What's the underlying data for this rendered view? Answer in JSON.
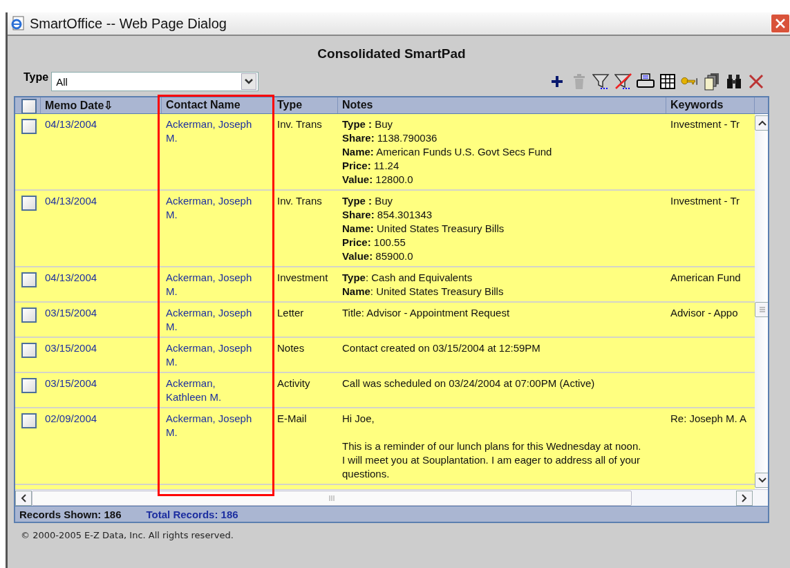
{
  "window": {
    "title": "SmartOffice -- Web Page Dialog"
  },
  "heading": "Consolidated SmartPad",
  "filter": {
    "label": "Type",
    "value": "All"
  },
  "toolbar": [
    {
      "kind": "add",
      "disabled": false
    },
    {
      "kind": "delete",
      "disabled": true
    },
    {
      "kind": "filter",
      "disabled": false
    },
    {
      "kind": "clear-filter",
      "disabled": false
    },
    {
      "kind": "print",
      "disabled": false
    },
    {
      "kind": "columns",
      "disabled": false
    },
    {
      "kind": "key",
      "disabled": false
    },
    {
      "kind": "copy",
      "disabled": false
    },
    {
      "kind": "find",
      "disabled": false
    },
    {
      "kind": "close",
      "disabled": false
    }
  ],
  "table": {
    "select_all": {
      "checked": false
    },
    "columns": [
      "Memo Date⇩",
      "Contact Name",
      "Type",
      "Notes",
      "Keywords"
    ],
    "rows": [
      {
        "checked": false,
        "date": "04/13/2004",
        "contact": "Ackerman, Joseph M.",
        "type": "Inv. Trans",
        "notes": {
          "kind": "fields",
          "lines": [
            "**Type :** Buy",
            "**Share:** 1138.790036",
            "**Name:** American Funds U.S. Govt Secs Fund",
            "**Price:** 11.24",
            "**Value:** 12800.0"
          ]
        },
        "keywords": "Investment - Tr"
      },
      {
        "checked": false,
        "date": "04/13/2004",
        "contact": "Ackerman, Joseph M.",
        "type": "Inv. Trans",
        "notes": {
          "kind": "fields",
          "lines": [
            "**Type :** Buy",
            "**Share:** 854.301343",
            "**Name:** United States Treasury Bills",
            "**Price:** 100.55",
            "**Value:** 85900.0"
          ]
        },
        "keywords": "Investment - Tr"
      },
      {
        "checked": false,
        "date": "04/13/2004",
        "contact": "Ackerman, Joseph M.",
        "type": "Investment",
        "notes": {
          "kind": "fields",
          "lines": [
            "**Type**: Cash and Equivalents",
            "**Name**: United States Treasury Bills"
          ]
        },
        "keywords": "American Fund"
      },
      {
        "checked": false,
        "date": "03/15/2004",
        "contact": "Ackerman, Joseph M.",
        "type": "Letter",
        "notes": {
          "kind": "fields",
          "lines": [
            "Title: Advisor - Appointment Request"
          ]
        },
        "keywords": "Advisor - Appo"
      },
      {
        "checked": false,
        "date": "03/15/2004",
        "contact": "Ackerman, Joseph M.",
        "type": "Notes",
        "notes": {
          "kind": "fields",
          "lines": [
            "Contact created on 03/15/2004 at 12:59PM"
          ]
        }
      },
      {
        "checked": false,
        "date": "03/15/2004",
        "contact": "Ackerman, Kathleen M.",
        "type": "Activity",
        "notes": {
          "kind": "fields",
          "lines": [
            "Call was scheduled on 03/24/2004 at 07:00PM (Active)"
          ]
        }
      },
      {
        "checked": false,
        "date": "02/09/2004",
        "contact": "Ackerman, Joseph M.",
        "type": "E-Mail",
        "notes": {
          "kind": "message",
          "lines": [
            "Hi Joe,",
            "This is a reminder of our lunch plans for this Wednesday at noon.  I will meet you at Souplantation.  I am eager to address all of your questions."
          ]
        },
        "keywords": "Re: Joseph M. A"
      }
    ]
  },
  "status": {
    "shown": "Records Shown: 186",
    "total": "Total Records: 186"
  },
  "copyright": "© 2000-2005 E-Z Data, Inc. All rights reserved."
}
